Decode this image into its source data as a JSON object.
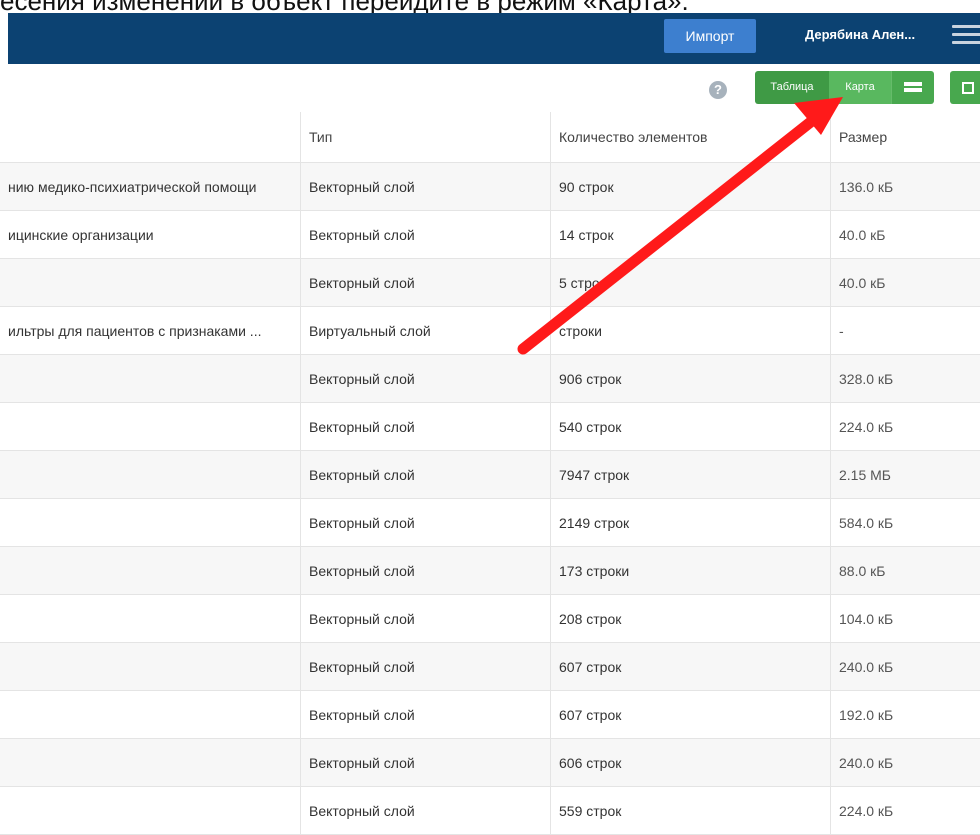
{
  "caption": "есения изменений в объект перейдите в режим «Карта».",
  "header": {
    "import_label": "Импорт",
    "user_name": "Дерябина Ален..."
  },
  "toolbar": {
    "help_symbol": "?",
    "table_label": "Таблица",
    "map_label": "Карта"
  },
  "columns": {
    "name": "",
    "type": "Тип",
    "count": "Количество элементов",
    "size": "Размер"
  },
  "rows": [
    {
      "name": "нию медико-психиатрической помощи",
      "type": "Векторный слой",
      "count": "90 строк",
      "size": "136.0 кБ"
    },
    {
      "name": "ицинские организации",
      "type": "Векторный слой",
      "count": "14 строк",
      "size": "40.0 кБ"
    },
    {
      "name": "",
      "type": "Векторный слой",
      "count": "5 строк",
      "size": "40.0 кБ"
    },
    {
      "name": "ильтры для пациентов с признаками ...",
      "type": "Виртуальный слой",
      "count": "строки",
      "size": "-"
    },
    {
      "name": "",
      "type": "Векторный слой",
      "count": "906 строк",
      "size": "328.0 кБ"
    },
    {
      "name": "",
      "type": "Векторный слой",
      "count": "540 строк",
      "size": "224.0 кБ"
    },
    {
      "name": "",
      "type": "Векторный слой",
      "count": "7947 строк",
      "size": "2.15 МБ"
    },
    {
      "name": "",
      "type": "Векторный слой",
      "count": "2149 строк",
      "size": "584.0 кБ"
    },
    {
      "name": "",
      "type": "Векторный слой",
      "count": "173 строки",
      "size": "88.0 кБ"
    },
    {
      "name": "",
      "type": "Векторный слой",
      "count": "208 строк",
      "size": "104.0 кБ"
    },
    {
      "name": "",
      "type": "Векторный слой",
      "count": "607 строк",
      "size": "240.0 кБ"
    },
    {
      "name": "",
      "type": "Векторный слой",
      "count": "607 строк",
      "size": "192.0 кБ"
    },
    {
      "name": "",
      "type": "Векторный слой",
      "count": "606 строк",
      "size": "240.0 кБ"
    },
    {
      "name": "",
      "type": "Векторный слой",
      "count": "559 строк",
      "size": "224.0 кБ"
    }
  ],
  "colors": {
    "navbar": "#0c4272",
    "accent_green": "#48a84e",
    "annotation_arrow": "#ff1a1a"
  },
  "icons": {
    "help": "help-icon",
    "layout": "layout-toggle-icon",
    "fullscreen": "fullscreen-icon",
    "menu": "hamburger-menu-icon"
  }
}
